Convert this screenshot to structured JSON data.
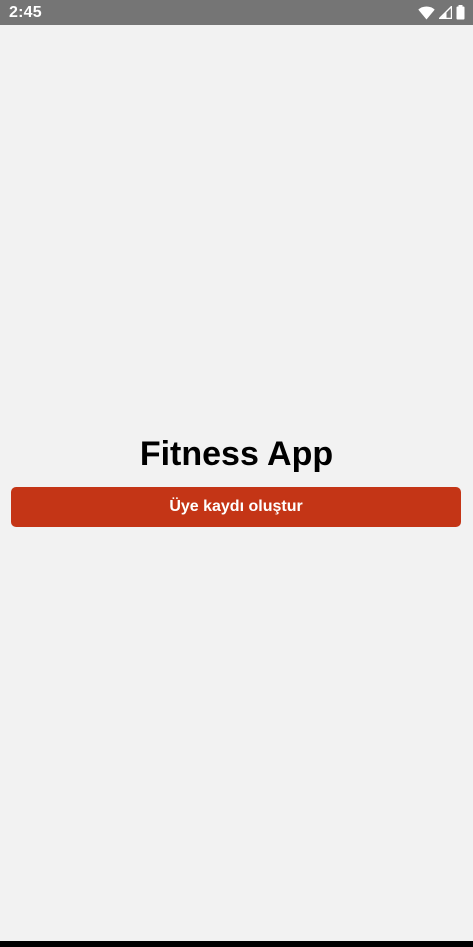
{
  "status_bar": {
    "time": "2:45",
    "icons": [
      "wifi-icon",
      "cellular-signal-icon",
      "battery-icon"
    ]
  },
  "app": {
    "title": "Fitness App",
    "register_button_label": "Üye kaydı oluştur"
  },
  "colors": {
    "status_bar_bg": "#757575",
    "background": "#f2f2f2",
    "button_bg": "#c43516",
    "button_text": "#ffffff",
    "title_text": "#000000"
  }
}
